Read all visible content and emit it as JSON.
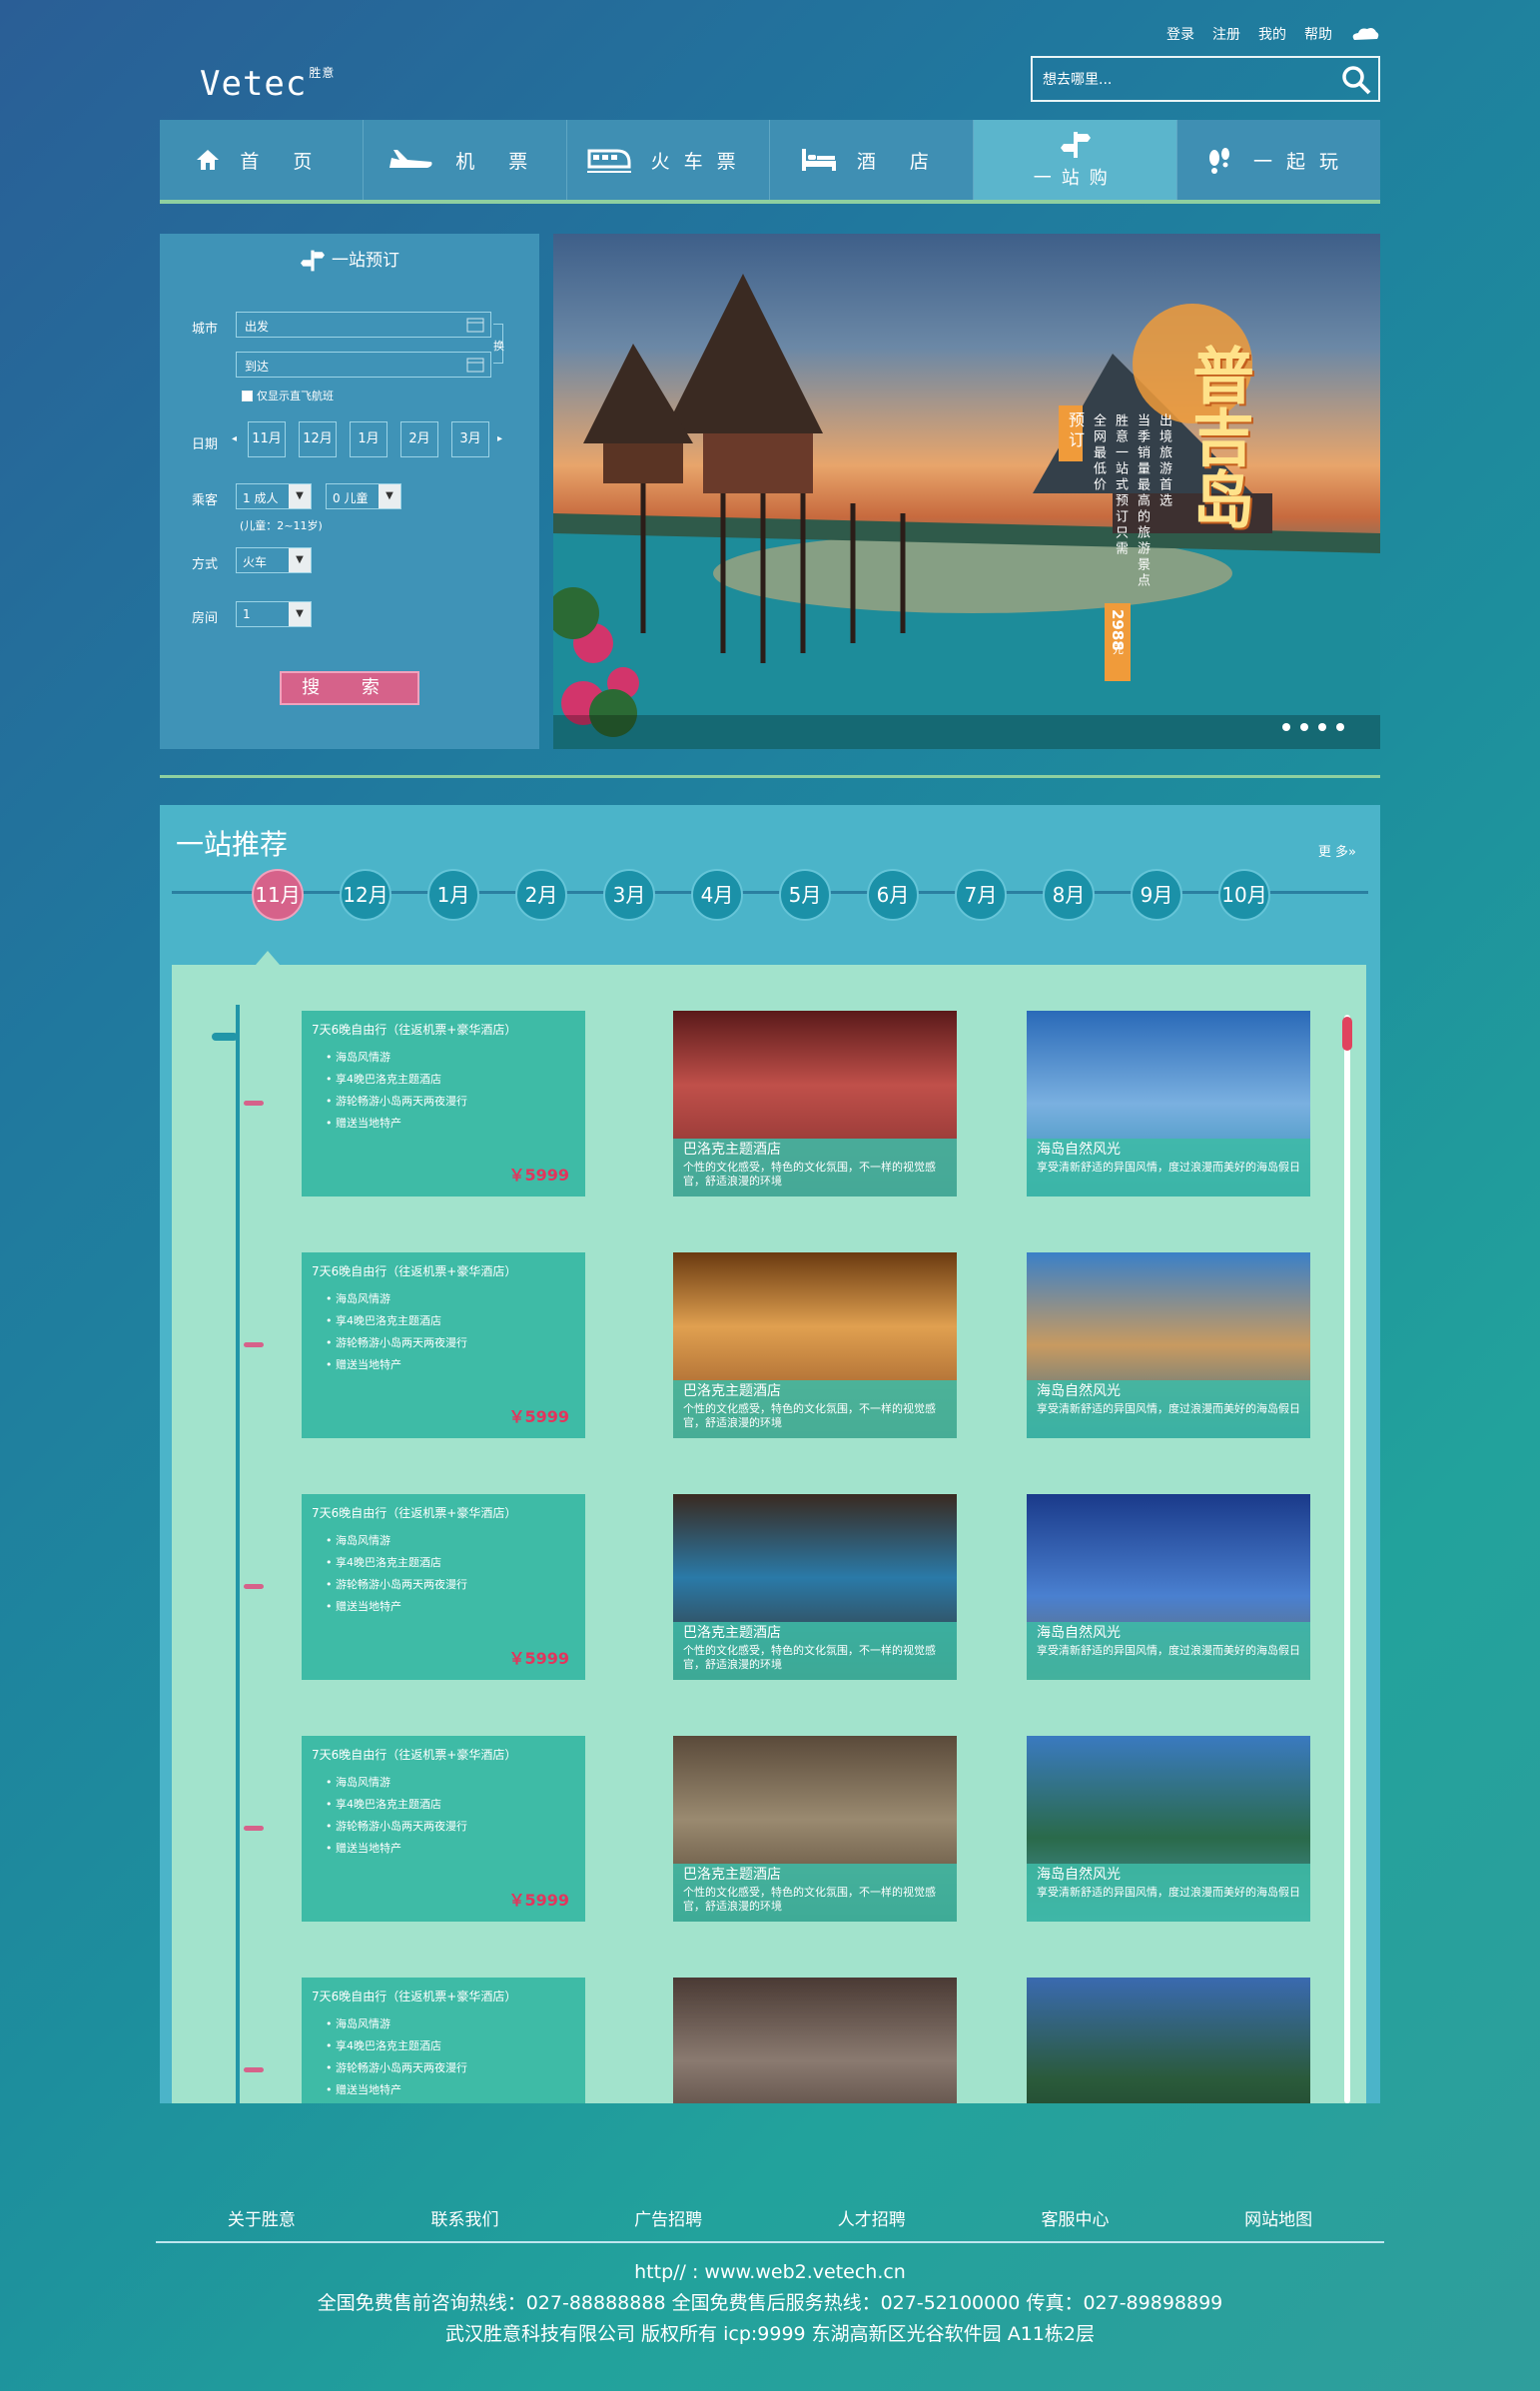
{
  "header": {
    "links": [
      "登录",
      "注册",
      "我的",
      "帮助"
    ],
    "logo_text": "Vetec",
    "logo_sub": "胜意",
    "search_placeholder": "想去哪里..."
  },
  "nav": [
    {
      "label": "首 页",
      "icon": "home-icon"
    },
    {
      "label": "机 票",
      "icon": "plane-icon"
    },
    {
      "label": "火车票",
      "icon": "train-icon"
    },
    {
      "label": "酒 店",
      "icon": "bed-icon"
    },
    {
      "label": "一站购",
      "icon": "signpost-icon",
      "active": true
    },
    {
      "label": "一起玩",
      "icon": "footprint-icon"
    }
  ],
  "booking": {
    "title": "一站预订",
    "city_label": "城市",
    "from_placeholder": "出发",
    "to_placeholder": "到达",
    "swap_label": "换",
    "direct_only": "仅显示直飞航班",
    "date_label": "日期",
    "months": [
      "11月",
      "12月",
      "1月",
      "2月",
      "3月"
    ],
    "passenger_label": "乘客",
    "adult": "1 成人",
    "child": "0 儿童",
    "child_note": "(儿童：2~11岁)",
    "mode_label": "方式",
    "mode_value": "火车",
    "room_label": "房间",
    "room_value": "1",
    "search_button": "搜 索"
  },
  "banner": {
    "title": "普吉岛",
    "col1": "出境旅游首选",
    "col2": "当季销量最高的旅游景点",
    "col3": "胜意一站式预订只需",
    "price": "2988",
    "unit": "元",
    "col4": "全网最低价",
    "tag": "预订",
    "dots": 4,
    "active_dot": 0
  },
  "recommend": {
    "title": "一站推荐",
    "more": "更 多»",
    "months": [
      "11月",
      "12月",
      "1月",
      "2月",
      "3月",
      "4月",
      "5月",
      "6月",
      "7月",
      "8月",
      "9月",
      "10月"
    ],
    "active_month": 0,
    "items": [
      {
        "title": "7天6晚自由行（往返机票+豪华酒店）",
        "bullets": [
          "海岛风情游",
          "享4晚巴洛克主题酒店",
          "游轮畅游小岛两天两夜漫行",
          "赠送当地特产"
        ],
        "price": "￥5999",
        "hotel_title": "巴洛克主题酒店",
        "hotel_desc": "个性的文化感受，特色的文化氛围，不一样的视觉感官，舒适浪漫的环境",
        "scene_title": "海岛自然风光",
        "scene_desc": "享受清新舒适的异国风情，度过浪漫而美好的海岛假日"
      },
      {
        "title": "7天6晚自由行（往返机票+豪华酒店）",
        "bullets": [
          "海岛风情游",
          "享4晚巴洛克主题酒店",
          "游轮畅游小岛两天两夜漫行",
          "赠送当地特产"
        ],
        "price": "￥5999",
        "hotel_title": "巴洛克主题酒店",
        "hotel_desc": "个性的文化感受，特色的文化氛围，不一样的视觉感官，舒适浪漫的环境",
        "scene_title": "海岛自然风光",
        "scene_desc": "享受清新舒适的异国风情，度过浪漫而美好的海岛假日"
      },
      {
        "title": "7天6晚自由行（往返机票+豪华酒店）",
        "bullets": [
          "海岛风情游",
          "享4晚巴洛克主题酒店",
          "游轮畅游小岛两天两夜漫行",
          "赠送当地特产"
        ],
        "price": "￥5999",
        "hotel_title": "巴洛克主题酒店",
        "hotel_desc": "个性的文化感受，特色的文化氛围，不一样的视觉感官，舒适浪漫的环境",
        "scene_title": "海岛自然风光",
        "scene_desc": "享受清新舒适的异国风情，度过浪漫而美好的海岛假日"
      },
      {
        "title": "7天6晚自由行（往返机票+豪华酒店）",
        "bullets": [
          "海岛风情游",
          "享4晚巴洛克主题酒店",
          "游轮畅游小岛两天两夜漫行",
          "赠送当地特产"
        ],
        "price": "￥5999",
        "hotel_title": "巴洛克主题酒店",
        "hotel_desc": "个性的文化感受，特色的文化氛围，不一样的视觉感官，舒适浪漫的环境",
        "scene_title": "海岛自然风光",
        "scene_desc": "享受清新舒适的异国风情，度过浪漫而美好的海岛假日"
      },
      {
        "title": "7天6晚自由行（往返机票+豪华酒店）",
        "bullets": [
          "海岛风情游",
          "享4晚巴洛克主题酒店",
          "游轮畅游小岛两天两夜漫行",
          "赠送当地特产"
        ],
        "price": "",
        "hotel_title": "",
        "hotel_desc": "",
        "scene_title": "",
        "scene_desc": ""
      }
    ]
  },
  "footer": {
    "links": [
      "关于胜意",
      "联系我们",
      "广告招聘",
      "人才招聘",
      "客服中心",
      "网站地图"
    ],
    "url": "http// : www.web2.vetech.cn",
    "hotline": "全国免费售前咨询热线：027-88888888  全国免费售后服务热线：027-52100000  传真：027-89898899",
    "copyright": "武汉胜意科技有限公司 版权所有  icp:9999  东湖高新区光谷软件园 A11栋2层"
  },
  "colors": {
    "accent": "#d6628a",
    "nav": "#3f8fb3",
    "content": "#a2e3cc",
    "card": "#3ebba6",
    "price": "#e2355c"
  }
}
